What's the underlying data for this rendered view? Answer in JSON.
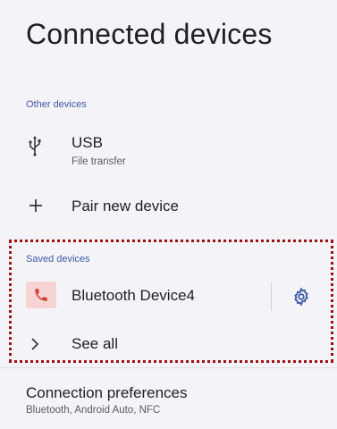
{
  "page": {
    "title": "Connected devices"
  },
  "other_devices": {
    "header": "Other devices",
    "usb": {
      "title": "USB",
      "subtitle": "File transfer",
      "icon": "usb-icon"
    },
    "pair": {
      "title": "Pair new device",
      "icon": "plus-icon"
    }
  },
  "saved_devices": {
    "header": "Saved devices",
    "device": {
      "name": "Bluetooth Device4",
      "icon": "phone-icon",
      "settings_icon": "gear-icon"
    },
    "see_all": {
      "label": "See all",
      "icon": "chevron-right-icon"
    }
  },
  "connection_preferences": {
    "title": "Connection preferences",
    "subtitle": "Bluetooth, Android Auto, NFC"
  },
  "colors": {
    "accent": "#3b5aa8",
    "phone_bg": "#f8d3d3",
    "phone_icon": "#d0403a",
    "highlight_border": "#a01010"
  }
}
